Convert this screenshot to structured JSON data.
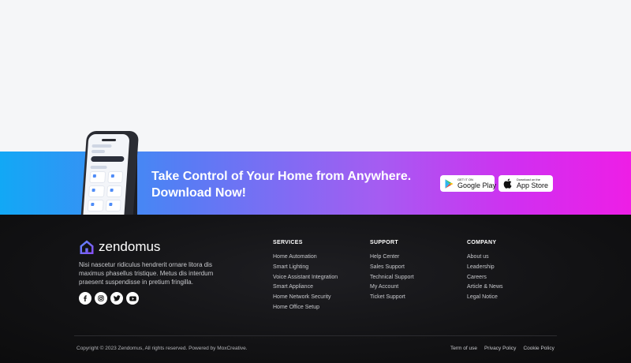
{
  "banner": {
    "title_line1": "Take Control of Your Home from Anywhere.",
    "title_line2": "Download Now!",
    "google_play": {
      "small": "GET IT ON",
      "big": "Google Play"
    },
    "app_store": {
      "small": "Download on the",
      "big": "App Store"
    }
  },
  "footer": {
    "brand": "zendomus",
    "about": "Nisi nascetur ridiculus hendrerit ornare litora dis maximus phasellus tristique. Metus dis interdum praesent suspendisse in pretium fringilla.",
    "socials": [
      "facebook-icon",
      "instagram-icon",
      "twitter-icon",
      "youtube-icon"
    ],
    "columns": {
      "services": {
        "title": "SERVICES",
        "links": [
          "Home Automation",
          "Smart Lighting",
          "Voice Assistant Integration",
          "Smart Appliance",
          "Home Network Security",
          "Home Office Setup"
        ]
      },
      "support": {
        "title": "SUPPORT",
        "links": [
          "Help Center",
          "Sales Support",
          "Technical Support",
          "My Account",
          "Ticket Support"
        ]
      },
      "company": {
        "title": "COMPANY",
        "links": [
          "About us",
          "Leadership",
          "Careers",
          "Article & News",
          "Legal Notice"
        ]
      }
    },
    "copyright": "Copyright © 2023 Zendomus, All rights reserved. Powered by MoxCreative.",
    "legal": [
      "Term of use",
      "Privacy Policy",
      "Cookie Policy"
    ]
  },
  "colors": {
    "gradient_start": "#12a8f5",
    "gradient_end": "#ee1ee6",
    "footer_bg": "#121214",
    "brand_icon": "#6b5cf5"
  }
}
